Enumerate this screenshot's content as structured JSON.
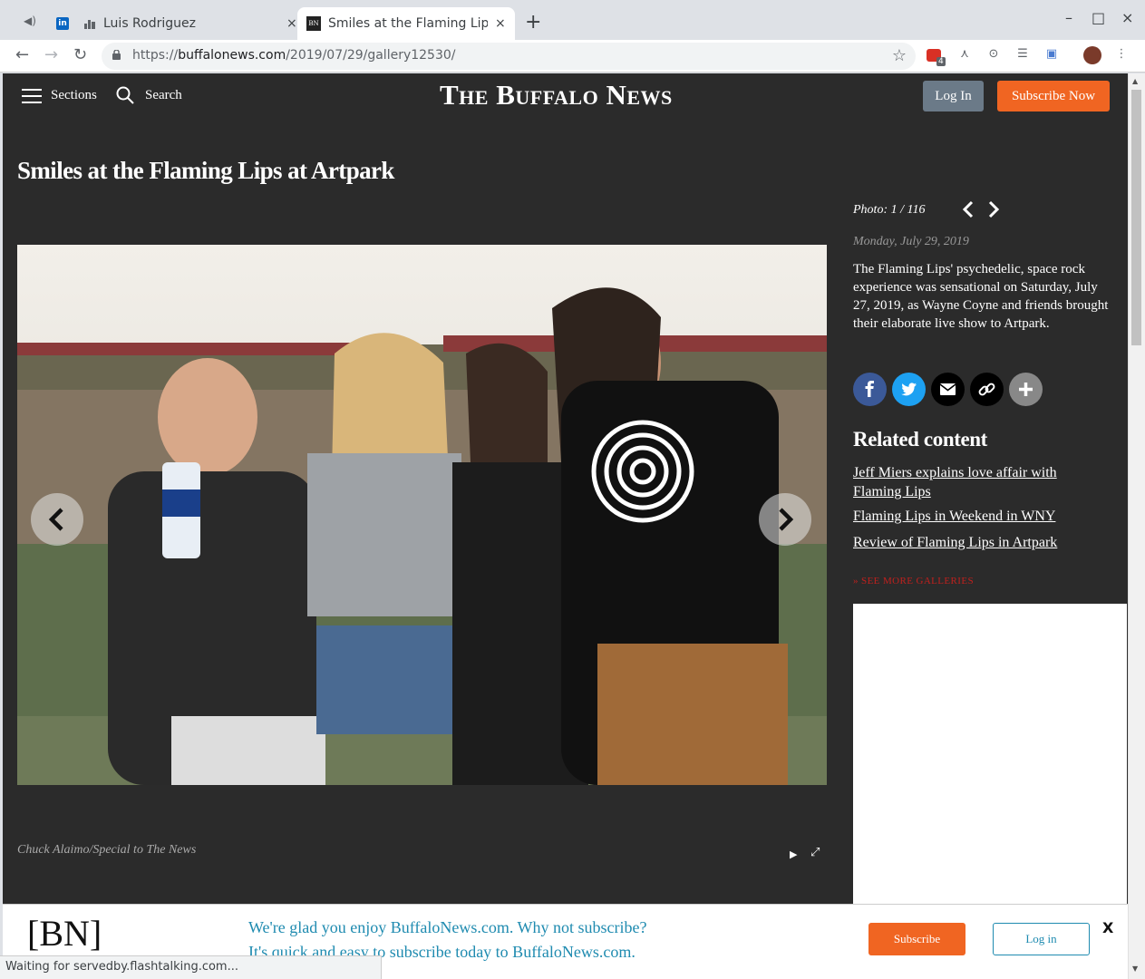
{
  "browser": {
    "tabs": [
      {
        "title": "Luis Rodriguez",
        "active": false
      },
      {
        "title": "Smiles at the Flaming Lips",
        "active": true,
        "close": "×"
      }
    ],
    "inactive_close": "×",
    "new_tab": "+",
    "window_controls": {
      "minimize": "–",
      "maximize": "□",
      "close": "×"
    },
    "nav": {
      "back": "←",
      "forward": "→",
      "reload": "↻"
    },
    "url": {
      "scheme": "https://",
      "host": "buffalonews.com",
      "path": "/2019/07/29/gallery12530/"
    },
    "star": "☆",
    "extension_badge": "4",
    "status_text": "Waiting for servedby.flashtalking.com..."
  },
  "header": {
    "sections_label": "Sections",
    "search_label": "Search",
    "masthead": "The Buffalo News",
    "login_label": "Log In",
    "subscribe_label": "Subscribe Now"
  },
  "gallery": {
    "title": "Smiles at the Flaming Lips at Artpark",
    "photo_counter": "Photo: 1 / 116",
    "date": "Monday, July 29, 2019",
    "caption": "The Flaming Lips' psychedelic, space rock experience was sensational on Saturday, July 27, 2019, as Wayne Coyne and friends brought their elaborate live show to Artpark.",
    "credit": "Chuck Alaimo/Special to The News",
    "play_icon": "▶",
    "expand_icon": "⤢"
  },
  "share": [
    "facebook-icon",
    "twitter-icon",
    "email-icon",
    "link-icon",
    "more-icon"
  ],
  "related": {
    "title": "Related content",
    "links": [
      "Jeff Miers explains love affair with Flaming Lips",
      "Flaming Lips in Weekend in WNY",
      "Review of Flaming Lips in Artpark"
    ],
    "see_more": "» SEE MORE GALLERIES"
  },
  "banner": {
    "logo": "[BN]",
    "line1": "We're glad you enjoy BuffaloNews.com. Why not subscribe?",
    "line2": "It's quick and easy to subscribe today to BuffaloNews.com.",
    "subscribe_label": "Subscribe",
    "login_label": "Log in",
    "close_label": "X"
  },
  "colors": {
    "page_bg": "#2b2b2b",
    "accent_orange": "#f06522",
    "banner_text": "#1f8bb0",
    "facebook": "#3b5998",
    "twitter": "#1da1f2"
  }
}
